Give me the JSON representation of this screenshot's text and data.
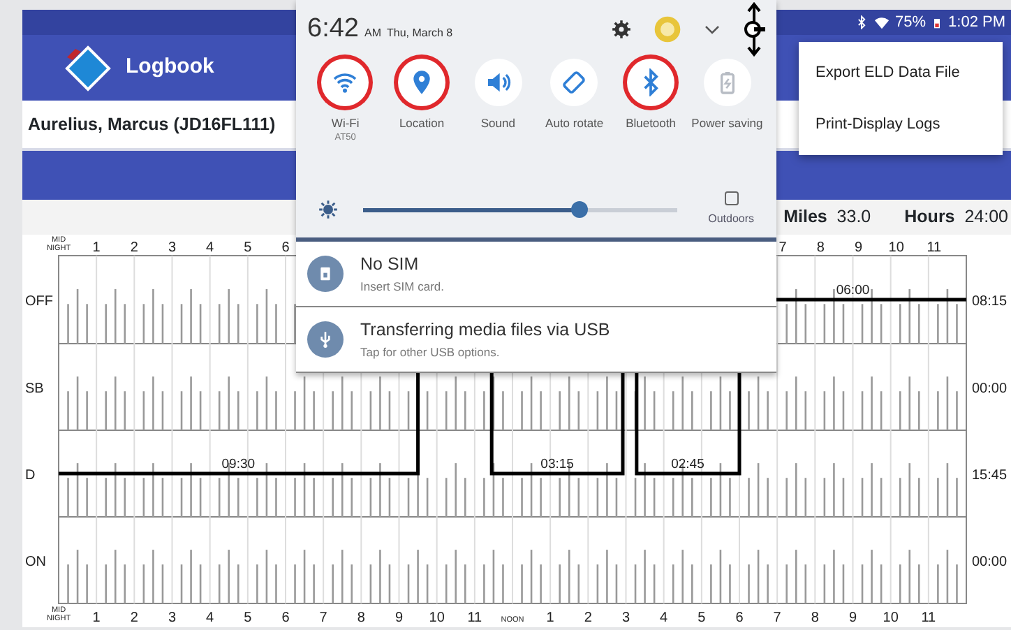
{
  "status_bar": {
    "battery": "75%",
    "time": "1:02 PM"
  },
  "app": {
    "title": "Logbook",
    "driver": "Aurelius, Marcus (JD16FL111)",
    "summary": [
      {
        "label": "Miles",
        "value": "33.0"
      },
      {
        "label": "Hours",
        "value": "24:00"
      }
    ]
  },
  "menu": {
    "items": [
      "Export ELD Data File",
      "Print-Display Logs"
    ]
  },
  "quick_panel": {
    "time": "6:42",
    "ampm": "AM",
    "date": "Thu, March 8",
    "tiles": [
      {
        "kind": "wifi",
        "label": "Wi-Fi",
        "sublabel": "AT50",
        "on": true,
        "highlighted": true
      },
      {
        "kind": "location",
        "label": "Location",
        "on": true,
        "highlighted": true
      },
      {
        "kind": "sound",
        "label": "Sound",
        "on": true,
        "highlighted": false
      },
      {
        "kind": "rotate",
        "label": "Auto rotate",
        "on": true,
        "highlighted": false
      },
      {
        "kind": "bluetooth",
        "label": "Bluetooth",
        "on": true,
        "highlighted": true
      },
      {
        "kind": "power",
        "label": "Power saving",
        "on": false,
        "highlighted": false
      }
    ],
    "brightness": {
      "level": 0.69
    },
    "outdoors": {
      "label": "Outdoors",
      "checked": false
    },
    "notifications": [
      {
        "kind": "sim",
        "title": "No SIM",
        "text": "Insert SIM card."
      },
      {
        "kind": "usb",
        "title": "Transferring media files via USB",
        "text": "Tap for other USB options."
      }
    ]
  },
  "log_graph": {
    "top_axis_start": [
      "MID NIGHT",
      "1",
      "2",
      "3",
      "4",
      "5",
      "6"
    ],
    "top_axis_end": [
      "7",
      "8",
      "9",
      "10",
      "11"
    ],
    "bottom_axis": [
      "MID NIGHT",
      "1",
      "2",
      "3",
      "4",
      "5",
      "6",
      "7",
      "8",
      "9",
      "10",
      "11",
      "NOON",
      "1",
      "2",
      "3",
      "4",
      "5",
      "6",
      "7",
      "8",
      "9",
      "10",
      "11"
    ],
    "rows": [
      {
        "kind": "off",
        "label": "OFF",
        "total": "08:15"
      },
      {
        "kind": "sleeper",
        "label": "SB",
        "total": "00:00"
      },
      {
        "kind": "driving",
        "label": "D",
        "total": "15:45"
      },
      {
        "kind": "on_duty",
        "label": "ON",
        "total": "00:00"
      }
    ],
    "duration_labels": [
      {
        "kind": "driving",
        "label": "09:30"
      },
      {
        "kind": "driving",
        "label": "03:15"
      },
      {
        "kind": "driving",
        "label": "02:45"
      },
      {
        "kind": "off",
        "label": "06:00"
      }
    ]
  }
}
